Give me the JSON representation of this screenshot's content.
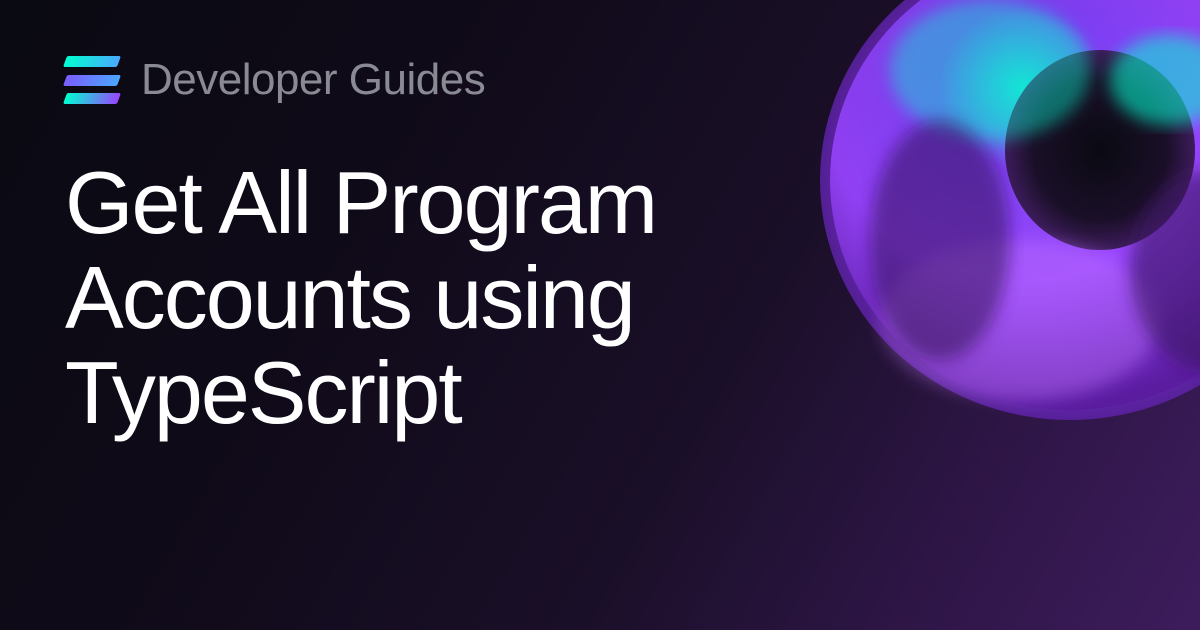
{
  "header": {
    "category": "Developer Guides"
  },
  "main": {
    "title": "Get All Program Accounts using TypeScript"
  },
  "brand": {
    "logo_name": "solana"
  }
}
